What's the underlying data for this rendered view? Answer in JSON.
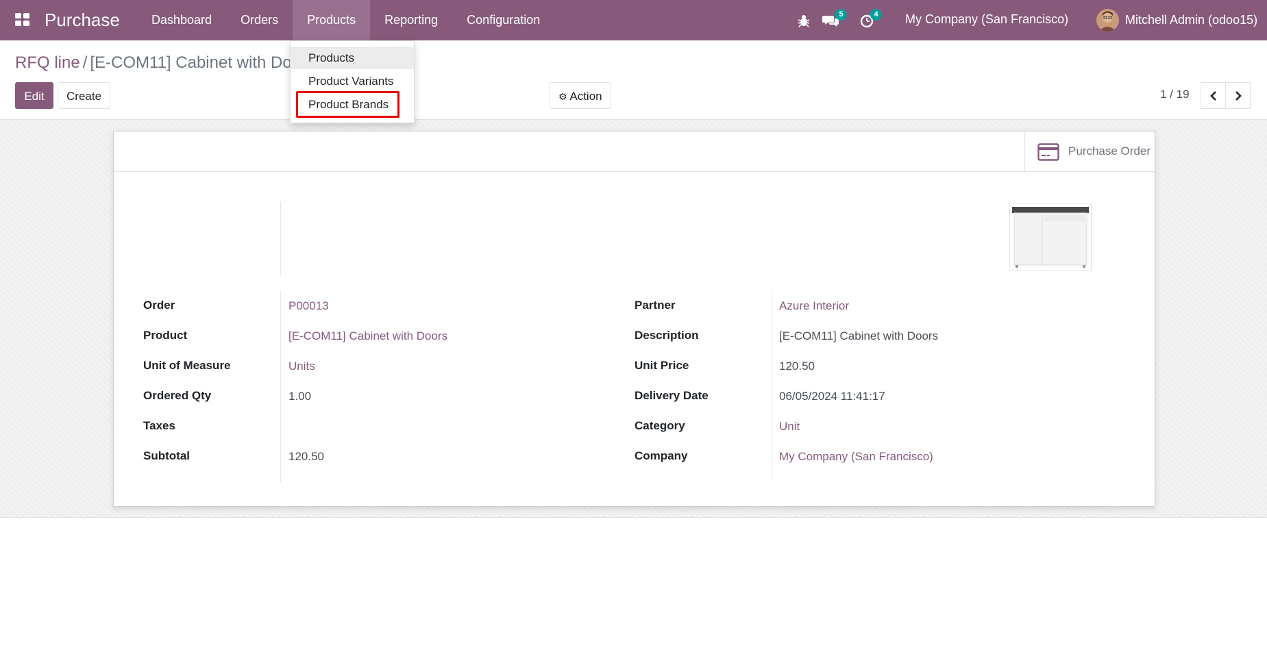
{
  "app": {
    "name": "Purchase"
  },
  "menu": [
    {
      "label": "Dashboard"
    },
    {
      "label": "Orders"
    },
    {
      "label": "Products"
    },
    {
      "label": "Reporting"
    },
    {
      "label": "Configuration"
    }
  ],
  "systray": {
    "messages_count": "5",
    "activities_count": "4",
    "company": "My Company (San Francisco)",
    "user": "Mitchell Admin (odoo15)"
  },
  "breadcrumb": {
    "parent": "RFQ line",
    "separator": "/",
    "current": "[E-COM11] Cabinet with Do"
  },
  "buttons": {
    "edit": "Edit",
    "create": "Create",
    "action": "Action"
  },
  "pager": {
    "value": "1 / 19"
  },
  "dropdown": {
    "items": [
      {
        "label": "Products"
      },
      {
        "label": "Product Variants"
      },
      {
        "label": "Product Brands"
      }
    ]
  },
  "smart_button": {
    "label": "Purchase Order"
  },
  "fields_left": [
    {
      "label": "Order",
      "value": "P00013"
    },
    {
      "label": "Product",
      "value": "[E-COM11] Cabinet with Doors"
    },
    {
      "label": "Unit of Measure",
      "value": "Units"
    },
    {
      "label": "Ordered Qty",
      "value": "1.00"
    },
    {
      "label": "Taxes",
      "value": ""
    },
    {
      "label": "Subtotal",
      "value": "120.50"
    }
  ],
  "fields_right": [
    {
      "label": "Partner",
      "value": "Azure Interior"
    },
    {
      "label": "Description",
      "value": "[E-COM11] Cabinet with Doors"
    },
    {
      "label": "Unit Price",
      "value": "120.50"
    },
    {
      "label": "Delivery Date",
      "value": "06/05/2024 11:41:17"
    },
    {
      "label": "Category",
      "value": "Unit"
    },
    {
      "label": "Company",
      "value": "My Company (San Francisco)"
    }
  ],
  "colors": {
    "brand": "#875a7b",
    "badge": "#00a09d",
    "highlight": "#e60000"
  }
}
